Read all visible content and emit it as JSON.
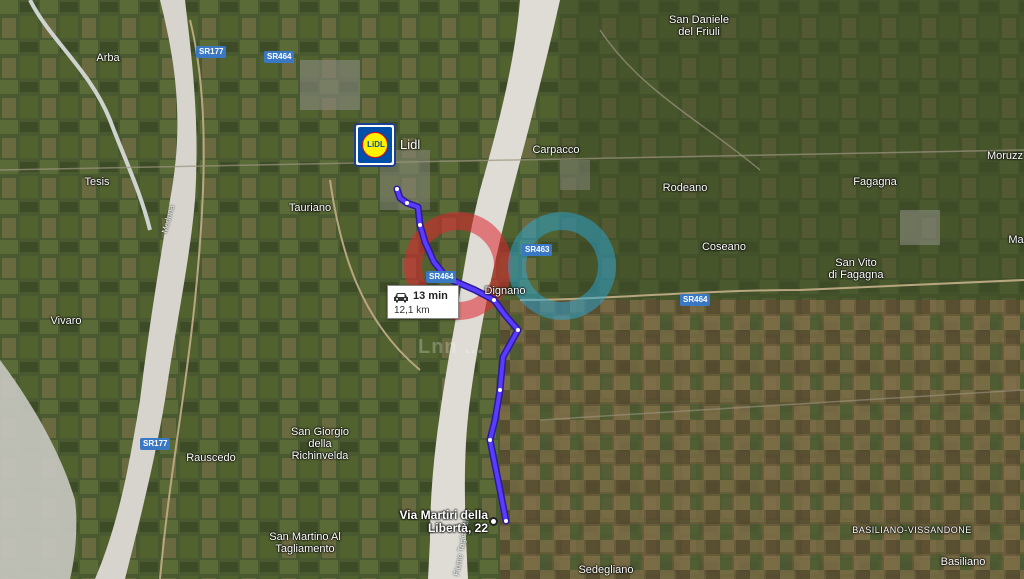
{
  "map": {
    "places": [
      {
        "name": "Arba"
      },
      {
        "name": "Tesis"
      },
      {
        "name": "Vivaro"
      },
      {
        "name": "Tauriano"
      },
      {
        "name": "Rauscedo"
      },
      {
        "name": "San Giorgio\ndella\nRichinvelda"
      },
      {
        "name": "San Martino Al\nTagliamento"
      },
      {
        "name": "San Daniele\ndel Friuli"
      },
      {
        "name": "Carpacco"
      },
      {
        "name": "Rodeano"
      },
      {
        "name": "Coseano"
      },
      {
        "name": "Dignano"
      },
      {
        "name": "Fagagna"
      },
      {
        "name": "Moruzz"
      },
      {
        "name": "San Vito\ndi Fagagna"
      },
      {
        "name": "Ma"
      },
      {
        "name": "BASILIANO-VISSANDONE"
      },
      {
        "name": "Basiliano"
      },
      {
        "name": "Sedegliano"
      }
    ],
    "road_shields": [
      {
        "label": "SR177"
      },
      {
        "label": "SR464"
      },
      {
        "label": "SR464"
      },
      {
        "label": "SR463"
      },
      {
        "label": "SR464"
      },
      {
        "label": "SR177"
      }
    ],
    "river_labels": [
      {
        "label": "Meduna"
      },
      {
        "label": "Fiume Tagliamento"
      }
    ]
  },
  "route": {
    "color": "#4a2cf0",
    "time": "13 min",
    "distance": "12,1 km",
    "icon": "car-icon"
  },
  "origin": {
    "label": "Lidl",
    "logo_text": "LiDL",
    "brand_colors": {
      "blue": "#0050aa",
      "yellow": "#fff200",
      "red": "#e60a14"
    }
  },
  "destination": {
    "label": "Via Martiri della\nLibertà, 22"
  },
  "watermark": {
    "text": "Lnn ..."
  }
}
